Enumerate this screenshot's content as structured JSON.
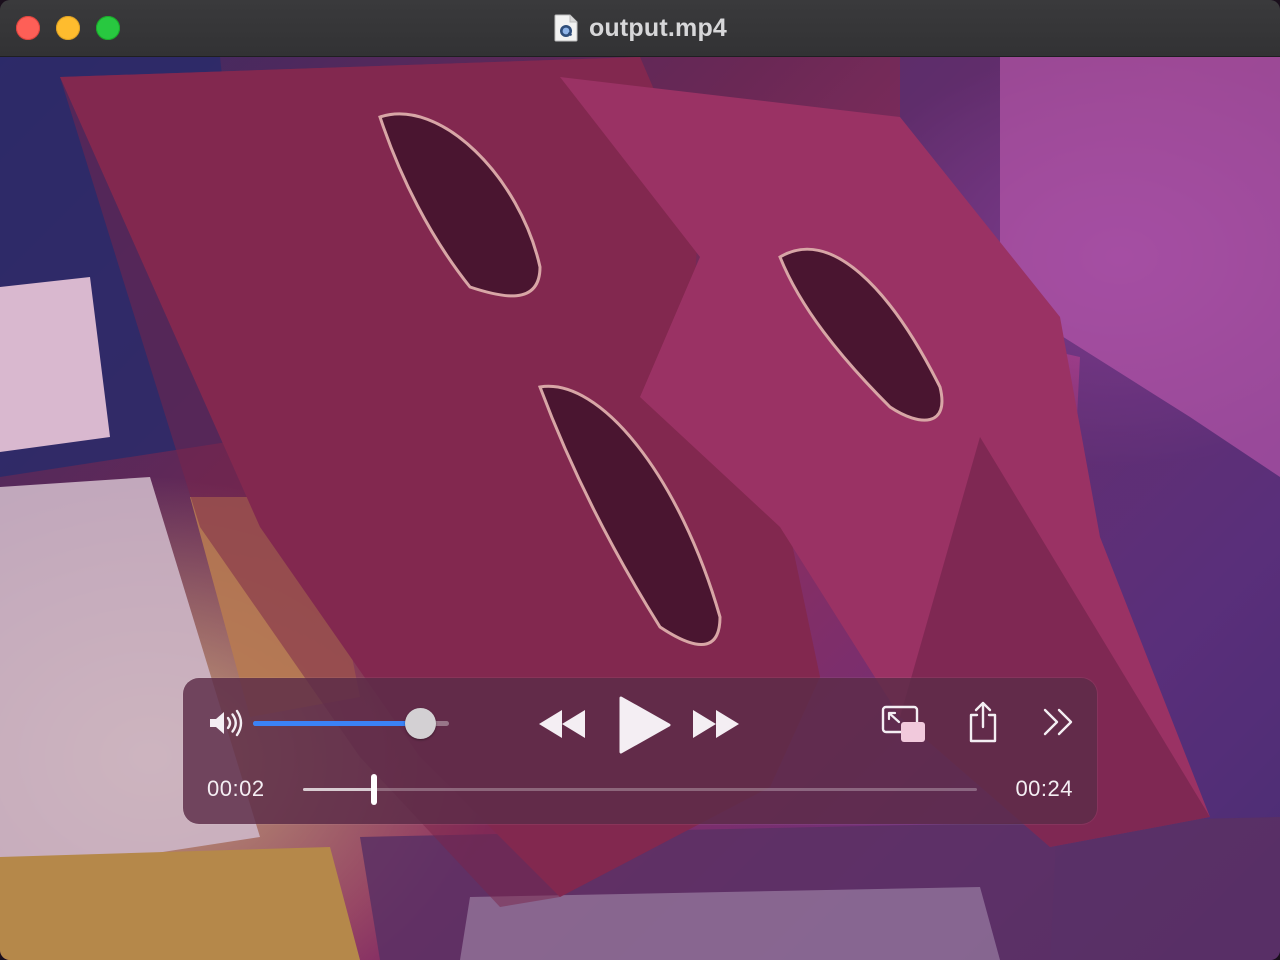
{
  "window": {
    "title": "output.mp4",
    "file_icon": "movie-document-icon"
  },
  "traffic_lights": {
    "close_color": "#fe5f57",
    "minimize_color": "#febc2e",
    "zoom_color": "#28c840"
  },
  "controls": {
    "volume_icon": "speaker-volume-icon",
    "volume_level": 0.92,
    "rewind_icon": "rewind-icon",
    "play_icon": "play-icon",
    "fast_forward_icon": "fast-forward-icon",
    "pip_icon": "picture-in-picture-icon",
    "share_icon": "share-icon",
    "more_icon": "chevron-double-right-icon",
    "accent_color": "#3b82f6"
  },
  "timeline": {
    "current": "00:02",
    "total": "00:24",
    "progress": 0.105
  }
}
